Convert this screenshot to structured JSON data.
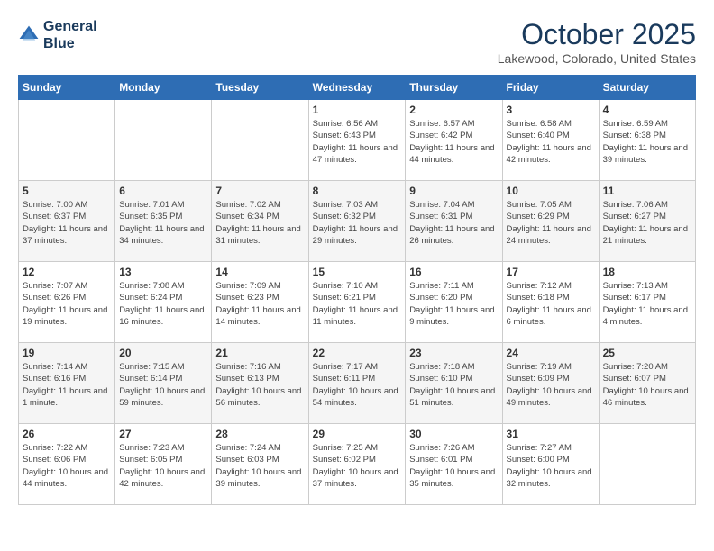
{
  "header": {
    "logo_line1": "General",
    "logo_line2": "Blue",
    "month": "October 2025",
    "location": "Lakewood, Colorado, United States"
  },
  "days_of_week": [
    "Sunday",
    "Monday",
    "Tuesday",
    "Wednesday",
    "Thursday",
    "Friday",
    "Saturday"
  ],
  "weeks": [
    [
      {
        "day": "",
        "content": ""
      },
      {
        "day": "",
        "content": ""
      },
      {
        "day": "",
        "content": ""
      },
      {
        "day": "1",
        "content": "Sunrise: 6:56 AM\nSunset: 6:43 PM\nDaylight: 11 hours\nand 47 minutes."
      },
      {
        "day": "2",
        "content": "Sunrise: 6:57 AM\nSunset: 6:42 PM\nDaylight: 11 hours\nand 44 minutes."
      },
      {
        "day": "3",
        "content": "Sunrise: 6:58 AM\nSunset: 6:40 PM\nDaylight: 11 hours\nand 42 minutes."
      },
      {
        "day": "4",
        "content": "Sunrise: 6:59 AM\nSunset: 6:38 PM\nDaylight: 11 hours\nand 39 minutes."
      }
    ],
    [
      {
        "day": "5",
        "content": "Sunrise: 7:00 AM\nSunset: 6:37 PM\nDaylight: 11 hours\nand 37 minutes."
      },
      {
        "day": "6",
        "content": "Sunrise: 7:01 AM\nSunset: 6:35 PM\nDaylight: 11 hours\nand 34 minutes."
      },
      {
        "day": "7",
        "content": "Sunrise: 7:02 AM\nSunset: 6:34 PM\nDaylight: 11 hours\nand 31 minutes."
      },
      {
        "day": "8",
        "content": "Sunrise: 7:03 AM\nSunset: 6:32 PM\nDaylight: 11 hours\nand 29 minutes."
      },
      {
        "day": "9",
        "content": "Sunrise: 7:04 AM\nSunset: 6:31 PM\nDaylight: 11 hours\nand 26 minutes."
      },
      {
        "day": "10",
        "content": "Sunrise: 7:05 AM\nSunset: 6:29 PM\nDaylight: 11 hours\nand 24 minutes."
      },
      {
        "day": "11",
        "content": "Sunrise: 7:06 AM\nSunset: 6:27 PM\nDaylight: 11 hours\nand 21 minutes."
      }
    ],
    [
      {
        "day": "12",
        "content": "Sunrise: 7:07 AM\nSunset: 6:26 PM\nDaylight: 11 hours\nand 19 minutes."
      },
      {
        "day": "13",
        "content": "Sunrise: 7:08 AM\nSunset: 6:24 PM\nDaylight: 11 hours\nand 16 minutes."
      },
      {
        "day": "14",
        "content": "Sunrise: 7:09 AM\nSunset: 6:23 PM\nDaylight: 11 hours\nand 14 minutes."
      },
      {
        "day": "15",
        "content": "Sunrise: 7:10 AM\nSunset: 6:21 PM\nDaylight: 11 hours\nand 11 minutes."
      },
      {
        "day": "16",
        "content": "Sunrise: 7:11 AM\nSunset: 6:20 PM\nDaylight: 11 hours\nand 9 minutes."
      },
      {
        "day": "17",
        "content": "Sunrise: 7:12 AM\nSunset: 6:18 PM\nDaylight: 11 hours\nand 6 minutes."
      },
      {
        "day": "18",
        "content": "Sunrise: 7:13 AM\nSunset: 6:17 PM\nDaylight: 11 hours\nand 4 minutes."
      }
    ],
    [
      {
        "day": "19",
        "content": "Sunrise: 7:14 AM\nSunset: 6:16 PM\nDaylight: 11 hours\nand 1 minute."
      },
      {
        "day": "20",
        "content": "Sunrise: 7:15 AM\nSunset: 6:14 PM\nDaylight: 10 hours\nand 59 minutes."
      },
      {
        "day": "21",
        "content": "Sunrise: 7:16 AM\nSunset: 6:13 PM\nDaylight: 10 hours\nand 56 minutes."
      },
      {
        "day": "22",
        "content": "Sunrise: 7:17 AM\nSunset: 6:11 PM\nDaylight: 10 hours\nand 54 minutes."
      },
      {
        "day": "23",
        "content": "Sunrise: 7:18 AM\nSunset: 6:10 PM\nDaylight: 10 hours\nand 51 minutes."
      },
      {
        "day": "24",
        "content": "Sunrise: 7:19 AM\nSunset: 6:09 PM\nDaylight: 10 hours\nand 49 minutes."
      },
      {
        "day": "25",
        "content": "Sunrise: 7:20 AM\nSunset: 6:07 PM\nDaylight: 10 hours\nand 46 minutes."
      }
    ],
    [
      {
        "day": "26",
        "content": "Sunrise: 7:22 AM\nSunset: 6:06 PM\nDaylight: 10 hours\nand 44 minutes."
      },
      {
        "day": "27",
        "content": "Sunrise: 7:23 AM\nSunset: 6:05 PM\nDaylight: 10 hours\nand 42 minutes."
      },
      {
        "day": "28",
        "content": "Sunrise: 7:24 AM\nSunset: 6:03 PM\nDaylight: 10 hours\nand 39 minutes."
      },
      {
        "day": "29",
        "content": "Sunrise: 7:25 AM\nSunset: 6:02 PM\nDaylight: 10 hours\nand 37 minutes."
      },
      {
        "day": "30",
        "content": "Sunrise: 7:26 AM\nSunset: 6:01 PM\nDaylight: 10 hours\nand 35 minutes."
      },
      {
        "day": "31",
        "content": "Sunrise: 7:27 AM\nSunset: 6:00 PM\nDaylight: 10 hours\nand 32 minutes."
      },
      {
        "day": "",
        "content": ""
      }
    ]
  ]
}
